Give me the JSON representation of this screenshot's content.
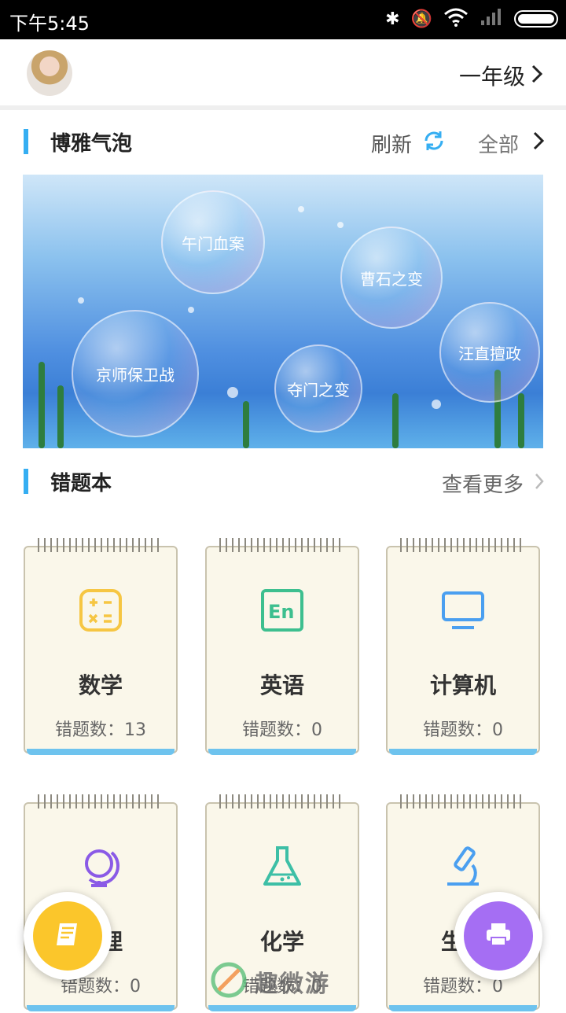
{
  "status": {
    "time": "下午5:45"
  },
  "header": {
    "grade": "一年级"
  },
  "bubbles_section": {
    "title": "博雅气泡",
    "refresh": "刷新",
    "all": "全部",
    "bubbles": [
      "午门血案",
      "曹石之变",
      "汪直擅政",
      "京师保卫战",
      "夺门之变"
    ]
  },
  "mistakes": {
    "title": "错题本",
    "more": "查看更多",
    "count_label": "错题数：",
    "subjects": [
      {
        "name": "数学",
        "count": "13"
      },
      {
        "name": "英语",
        "count": "0"
      },
      {
        "name": "计算机",
        "count": "0"
      },
      {
        "name": "地理",
        "count": "0"
      },
      {
        "name": "化学",
        "count": "0"
      },
      {
        "name": "生物",
        "count": "0"
      }
    ]
  },
  "watermark": "趣微游",
  "colors": {
    "accent": "#35aef2",
    "math": "#f6c643",
    "english": "#3dbf8f",
    "computer": "#4a9ff0",
    "geo": "#8a5ae6",
    "chem": "#3dbfa6",
    "bio": "#4a9ff0",
    "fab_left": "#fbc62b",
    "fab_right": "#a56ef3"
  }
}
